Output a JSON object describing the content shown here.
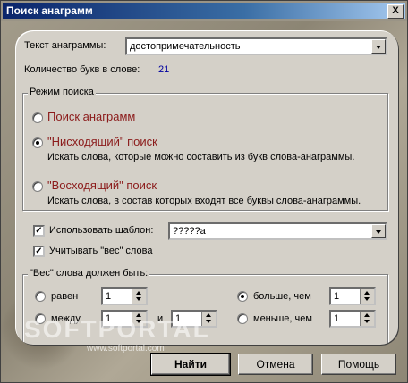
{
  "window": {
    "title": "Поиск анаграмм",
    "close_label": "X"
  },
  "anagram": {
    "label": "Текст анаграммы:",
    "value": "достопримечательность"
  },
  "letters": {
    "label": "Количество букв в слове:",
    "value": "21"
  },
  "mode": {
    "group_title": "Режим поиска",
    "options": [
      {
        "label": "Поиск анаграмм",
        "desc": "",
        "selected": false
      },
      {
        "label": "\"Нисходящий\" поиск",
        "desc": "Искать слова, которые можно составить из букв слова-анаграммы.",
        "selected": true
      },
      {
        "label": "\"Восходящий\" поиск",
        "desc": "Искать слова, в состав которых входят все буквы слова-анаграммы.",
        "selected": false
      }
    ]
  },
  "template": {
    "label": "Использовать шаблон:",
    "value": "?????а",
    "checked": true
  },
  "weight_check": {
    "label": "Учитывать \"вес\" слова",
    "checked": true
  },
  "weight": {
    "group_title": "\"Вес\" слова должен быть:",
    "equal_label": "равен",
    "equal_value": "1",
    "between_label": "между",
    "between_from": "1",
    "and_label": "и",
    "between_to": "1",
    "more_label": "больше, чем",
    "more_value": "1",
    "less_label": "меньше, чем",
    "less_value": "1"
  },
  "buttons": {
    "find": "Найти",
    "cancel": "Отмена",
    "help": "Помощь"
  },
  "watermark": {
    "text": "SOFTPORTAL",
    "sub": "www.softportal.com"
  },
  "colors": {
    "accent_red": "#8b1a1a",
    "count_blue": "#0000a0",
    "title_blue": "#0a246a"
  }
}
